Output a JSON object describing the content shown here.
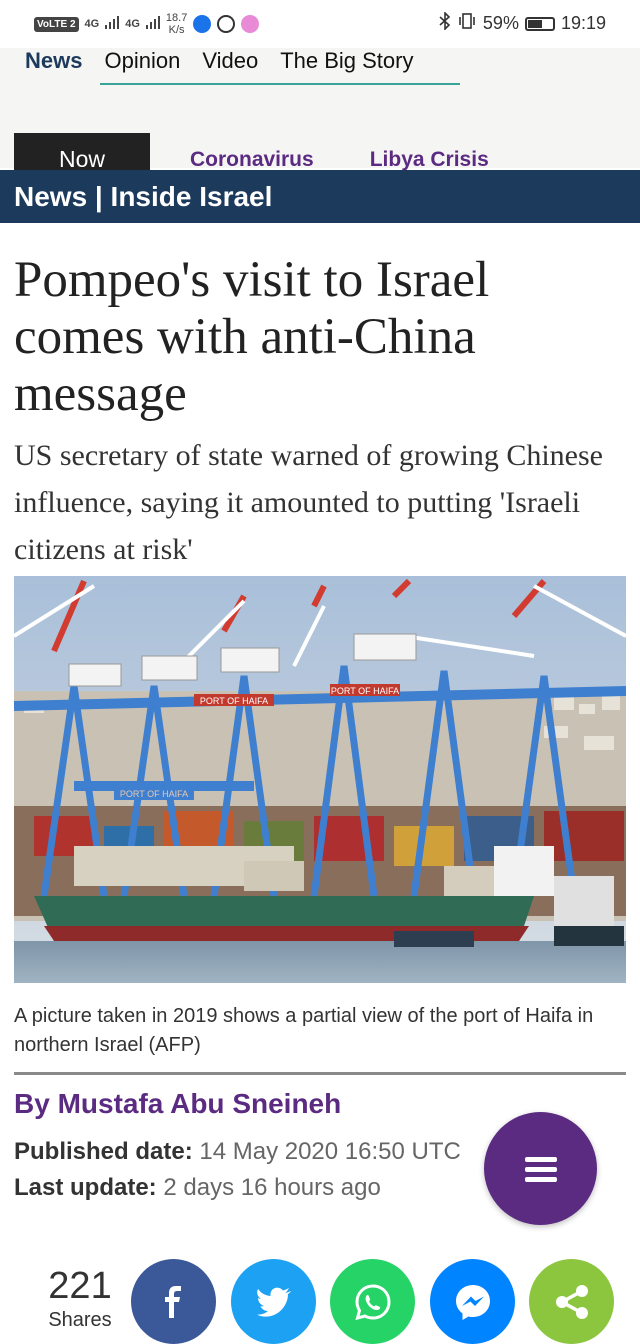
{
  "status_bar": {
    "volte": "VoLTE 2",
    "net1": "4G",
    "net2": "4G",
    "speed_value": "18.7",
    "speed_unit": "K/s",
    "battery": "59%",
    "battery_level": 0.59,
    "time": "19:19"
  },
  "nav": {
    "sections": [
      "News",
      "Opinion",
      "Video",
      "The Big Story"
    ],
    "tags": [
      "Now",
      "Coronavirus",
      "Libya Crisis"
    ]
  },
  "section_title": "News | Inside Israel",
  "article": {
    "headline": "Pompeo's visit to Israel comes with anti-China message",
    "standfirst": "US secretary of state warned of growing Chinese influence, saying it amounted to putting 'Israeli citizens at risk'",
    "image_signs": [
      "PORT OF HAIFA",
      "PORT OF HAIFA",
      "PORT OF HAIFA"
    ],
    "caption": "A picture taken in 2019 shows a partial view of the port of Haifa in northern Israel (AFP)",
    "byline": "By Mustafa Abu Sneineh",
    "published_label": "Published date:",
    "published_value": "14 May 2020 16:50 UTC",
    "updated_label": "Last update:",
    "updated_value": "2 days 16 hours ago"
  },
  "share": {
    "count": "221",
    "label": "Shares",
    "buttons": [
      {
        "name": "facebook",
        "icon": "facebook-icon",
        "color": "#3b5998"
      },
      {
        "name": "twitter",
        "icon": "twitter-icon",
        "color": "#1da1f2"
      },
      {
        "name": "whatsapp",
        "icon": "whatsapp-icon",
        "color": "#25d366"
      },
      {
        "name": "messenger",
        "icon": "messenger-icon",
        "color": "#0084ff"
      },
      {
        "name": "share",
        "icon": "share-icon",
        "color": "#8cc63f"
      }
    ]
  },
  "menu_fab": {
    "icon": "menu-icon",
    "color": "#5b2b82"
  }
}
